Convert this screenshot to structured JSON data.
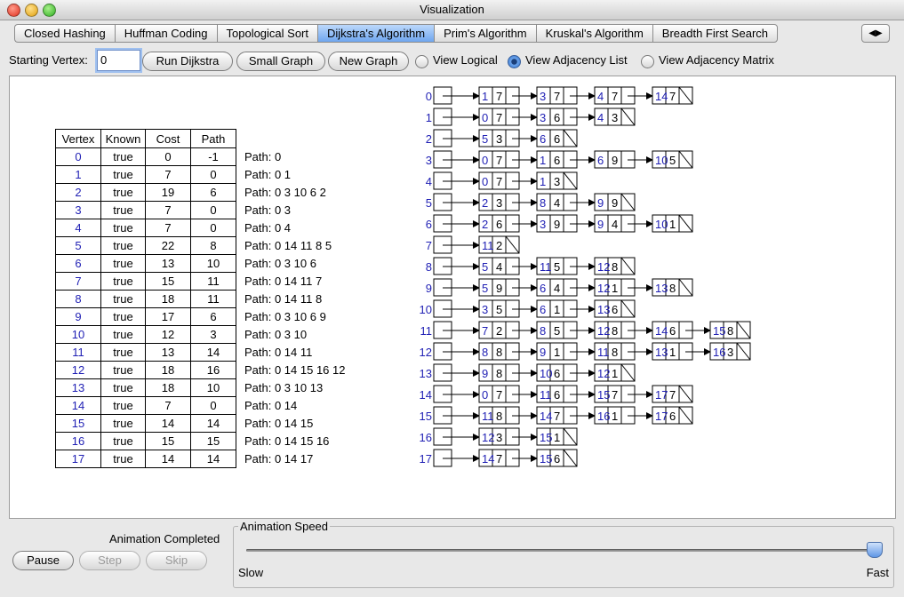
{
  "window": {
    "title": "Visualization"
  },
  "tabs": [
    "Closed Hashing",
    "Huffman Coding",
    "Topological Sort",
    "Dijkstra's Algorithm",
    "Prim's Algorithm",
    "Kruskal's Algorithm",
    "Breadth First Search"
  ],
  "active_tab": "Dijkstra's Algorithm",
  "tab_scroll_label": "◀▶",
  "controls": {
    "starting_vertex_label": "Starting Vertex:",
    "starting_vertex_value": "0",
    "run_button": "Run Dijkstra",
    "small_graph_button": "Small Graph",
    "new_graph_button": "New Graph",
    "view_options": [
      {
        "label": "View Logical",
        "checked": false
      },
      {
        "label": "View Adjacency List",
        "checked": true
      },
      {
        "label": "View Adjacency Matrix",
        "checked": false
      }
    ]
  },
  "table": {
    "headers": [
      "Vertex",
      "Known",
      "Cost",
      "Path"
    ],
    "rows": [
      [
        "0",
        "true",
        "0",
        "-1",
        "Path: 0"
      ],
      [
        "1",
        "true",
        "7",
        "0",
        "Path: 0 1"
      ],
      [
        "2",
        "true",
        "19",
        "6",
        "Path: 0 3 10 6 2"
      ],
      [
        "3",
        "true",
        "7",
        "0",
        "Path: 0 3"
      ],
      [
        "4",
        "true",
        "7",
        "0",
        "Path: 0 4"
      ],
      [
        "5",
        "true",
        "22",
        "8",
        "Path: 0 14 11 8 5"
      ],
      [
        "6",
        "true",
        "13",
        "10",
        "Path: 0 3 10 6"
      ],
      [
        "7",
        "true",
        "15",
        "11",
        "Path: 0 14 11 7"
      ],
      [
        "8",
        "true",
        "18",
        "11",
        "Path: 0 14 11 8"
      ],
      [
        "9",
        "true",
        "17",
        "6",
        "Path: 0 3 10 6 9"
      ],
      [
        "10",
        "true",
        "12",
        "3",
        "Path: 0 3 10"
      ],
      [
        "11",
        "true",
        "13",
        "14",
        "Path: 0 14 11"
      ],
      [
        "12",
        "true",
        "18",
        "16",
        "Path: 0 14 15 16 12"
      ],
      [
        "13",
        "true",
        "18",
        "10",
        "Path: 0 3 10 13"
      ],
      [
        "14",
        "true",
        "7",
        "0",
        "Path: 0 14"
      ],
      [
        "15",
        "true",
        "14",
        "14",
        "Path: 0 14 15"
      ],
      [
        "16",
        "true",
        "15",
        "15",
        "Path: 0 14 15 16"
      ],
      [
        "17",
        "true",
        "14",
        "14",
        "Path: 0 14 17"
      ]
    ]
  },
  "adjacency": [
    {
      "vertex": "0",
      "edges": [
        [
          "1",
          "7"
        ],
        [
          "3",
          "7"
        ],
        [
          "4",
          "7"
        ],
        [
          "14",
          "7"
        ]
      ]
    },
    {
      "vertex": "1",
      "edges": [
        [
          "0",
          "7"
        ],
        [
          "3",
          "6"
        ],
        [
          "4",
          "3"
        ]
      ]
    },
    {
      "vertex": "2",
      "edges": [
        [
          "5",
          "3"
        ],
        [
          "6",
          "6"
        ]
      ]
    },
    {
      "vertex": "3",
      "edges": [
        [
          "0",
          "7"
        ],
        [
          "1",
          "6"
        ],
        [
          "6",
          "9"
        ],
        [
          "10",
          "5"
        ]
      ]
    },
    {
      "vertex": "4",
      "edges": [
        [
          "0",
          "7"
        ],
        [
          "1",
          "3"
        ]
      ]
    },
    {
      "vertex": "5",
      "edges": [
        [
          "2",
          "3"
        ],
        [
          "8",
          "4"
        ],
        [
          "9",
          "9"
        ]
      ]
    },
    {
      "vertex": "6",
      "edges": [
        [
          "2",
          "6"
        ],
        [
          "3",
          "9"
        ],
        [
          "9",
          "4"
        ],
        [
          "10",
          "1"
        ]
      ]
    },
    {
      "vertex": "7",
      "edges": [
        [
          "11",
          "2"
        ]
      ]
    },
    {
      "vertex": "8",
      "edges": [
        [
          "5",
          "4"
        ],
        [
          "11",
          "5"
        ],
        [
          "12",
          "8"
        ]
      ]
    },
    {
      "vertex": "9",
      "edges": [
        [
          "5",
          "9"
        ],
        [
          "6",
          "4"
        ],
        [
          "12",
          "1"
        ],
        [
          "13",
          "8"
        ]
      ]
    },
    {
      "vertex": "10",
      "edges": [
        [
          "3",
          "5"
        ],
        [
          "6",
          "1"
        ],
        [
          "13",
          "6"
        ]
      ]
    },
    {
      "vertex": "11",
      "edges": [
        [
          "7",
          "2"
        ],
        [
          "8",
          "5"
        ],
        [
          "12",
          "8"
        ],
        [
          "14",
          "6"
        ],
        [
          "15",
          "8"
        ]
      ]
    },
    {
      "vertex": "12",
      "edges": [
        [
          "8",
          "8"
        ],
        [
          "9",
          "1"
        ],
        [
          "11",
          "8"
        ],
        [
          "13",
          "1"
        ],
        [
          "16",
          "3"
        ]
      ]
    },
    {
      "vertex": "13",
      "edges": [
        [
          "9",
          "8"
        ],
        [
          "10",
          "6"
        ],
        [
          "12",
          "1"
        ]
      ]
    },
    {
      "vertex": "14",
      "edges": [
        [
          "0",
          "7"
        ],
        [
          "11",
          "6"
        ],
        [
          "15",
          "7"
        ],
        [
          "17",
          "7"
        ]
      ]
    },
    {
      "vertex": "15",
      "edges": [
        [
          "11",
          "8"
        ],
        [
          "14",
          "7"
        ],
        [
          "16",
          "1"
        ],
        [
          "17",
          "6"
        ]
      ]
    },
    {
      "vertex": "16",
      "edges": [
        [
          "12",
          "3"
        ],
        [
          "15",
          "1"
        ]
      ]
    },
    {
      "vertex": "17",
      "edges": [
        [
          "14",
          "7"
        ],
        [
          "15",
          "6"
        ]
      ]
    }
  ],
  "bottom": {
    "status": "Animation Completed",
    "pause_button": "Pause",
    "step_button": "Step",
    "skip_button": "Skip",
    "speed_legend": "Animation Speed",
    "slow_label": "Slow",
    "fast_label": "Fast",
    "speed_value": 1.0
  },
  "colors": {
    "vertex_blue": "#1f1fb4",
    "tab_active": "#6fa6ef"
  }
}
